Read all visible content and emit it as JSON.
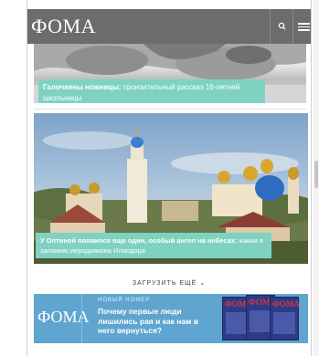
{
  "header": {
    "logo": "ФОМА",
    "search_icon": "search-icon",
    "menu_icon": "hamburger-menu-icon"
  },
  "articles": [
    {
      "title": "Галочкины ножницы:",
      "subtitle": "пронзительный рассказ 16-летней школьницы"
    },
    {
      "title": "У Оптиной появился еще один, особый ангел на небесах:",
      "subtitle": "каким я запомню иеродиакона Илиодора"
    }
  ],
  "load_more": {
    "label": "ЗАГРУЗИТЬ ЕЩЁ",
    "icon": "chevron-down-icon"
  },
  "promo": {
    "logo": "ФОМА",
    "tag": "НОВЫЙ НОМЕР",
    "text": "Почему первые люди лишились рая и как нам в него вернуться?",
    "cover_title": "ФОМА"
  },
  "colors": {
    "header_bg": "#6c6c6c",
    "caption_bg": "#7fd2c2",
    "promo_bg": "#5fa5cf"
  }
}
